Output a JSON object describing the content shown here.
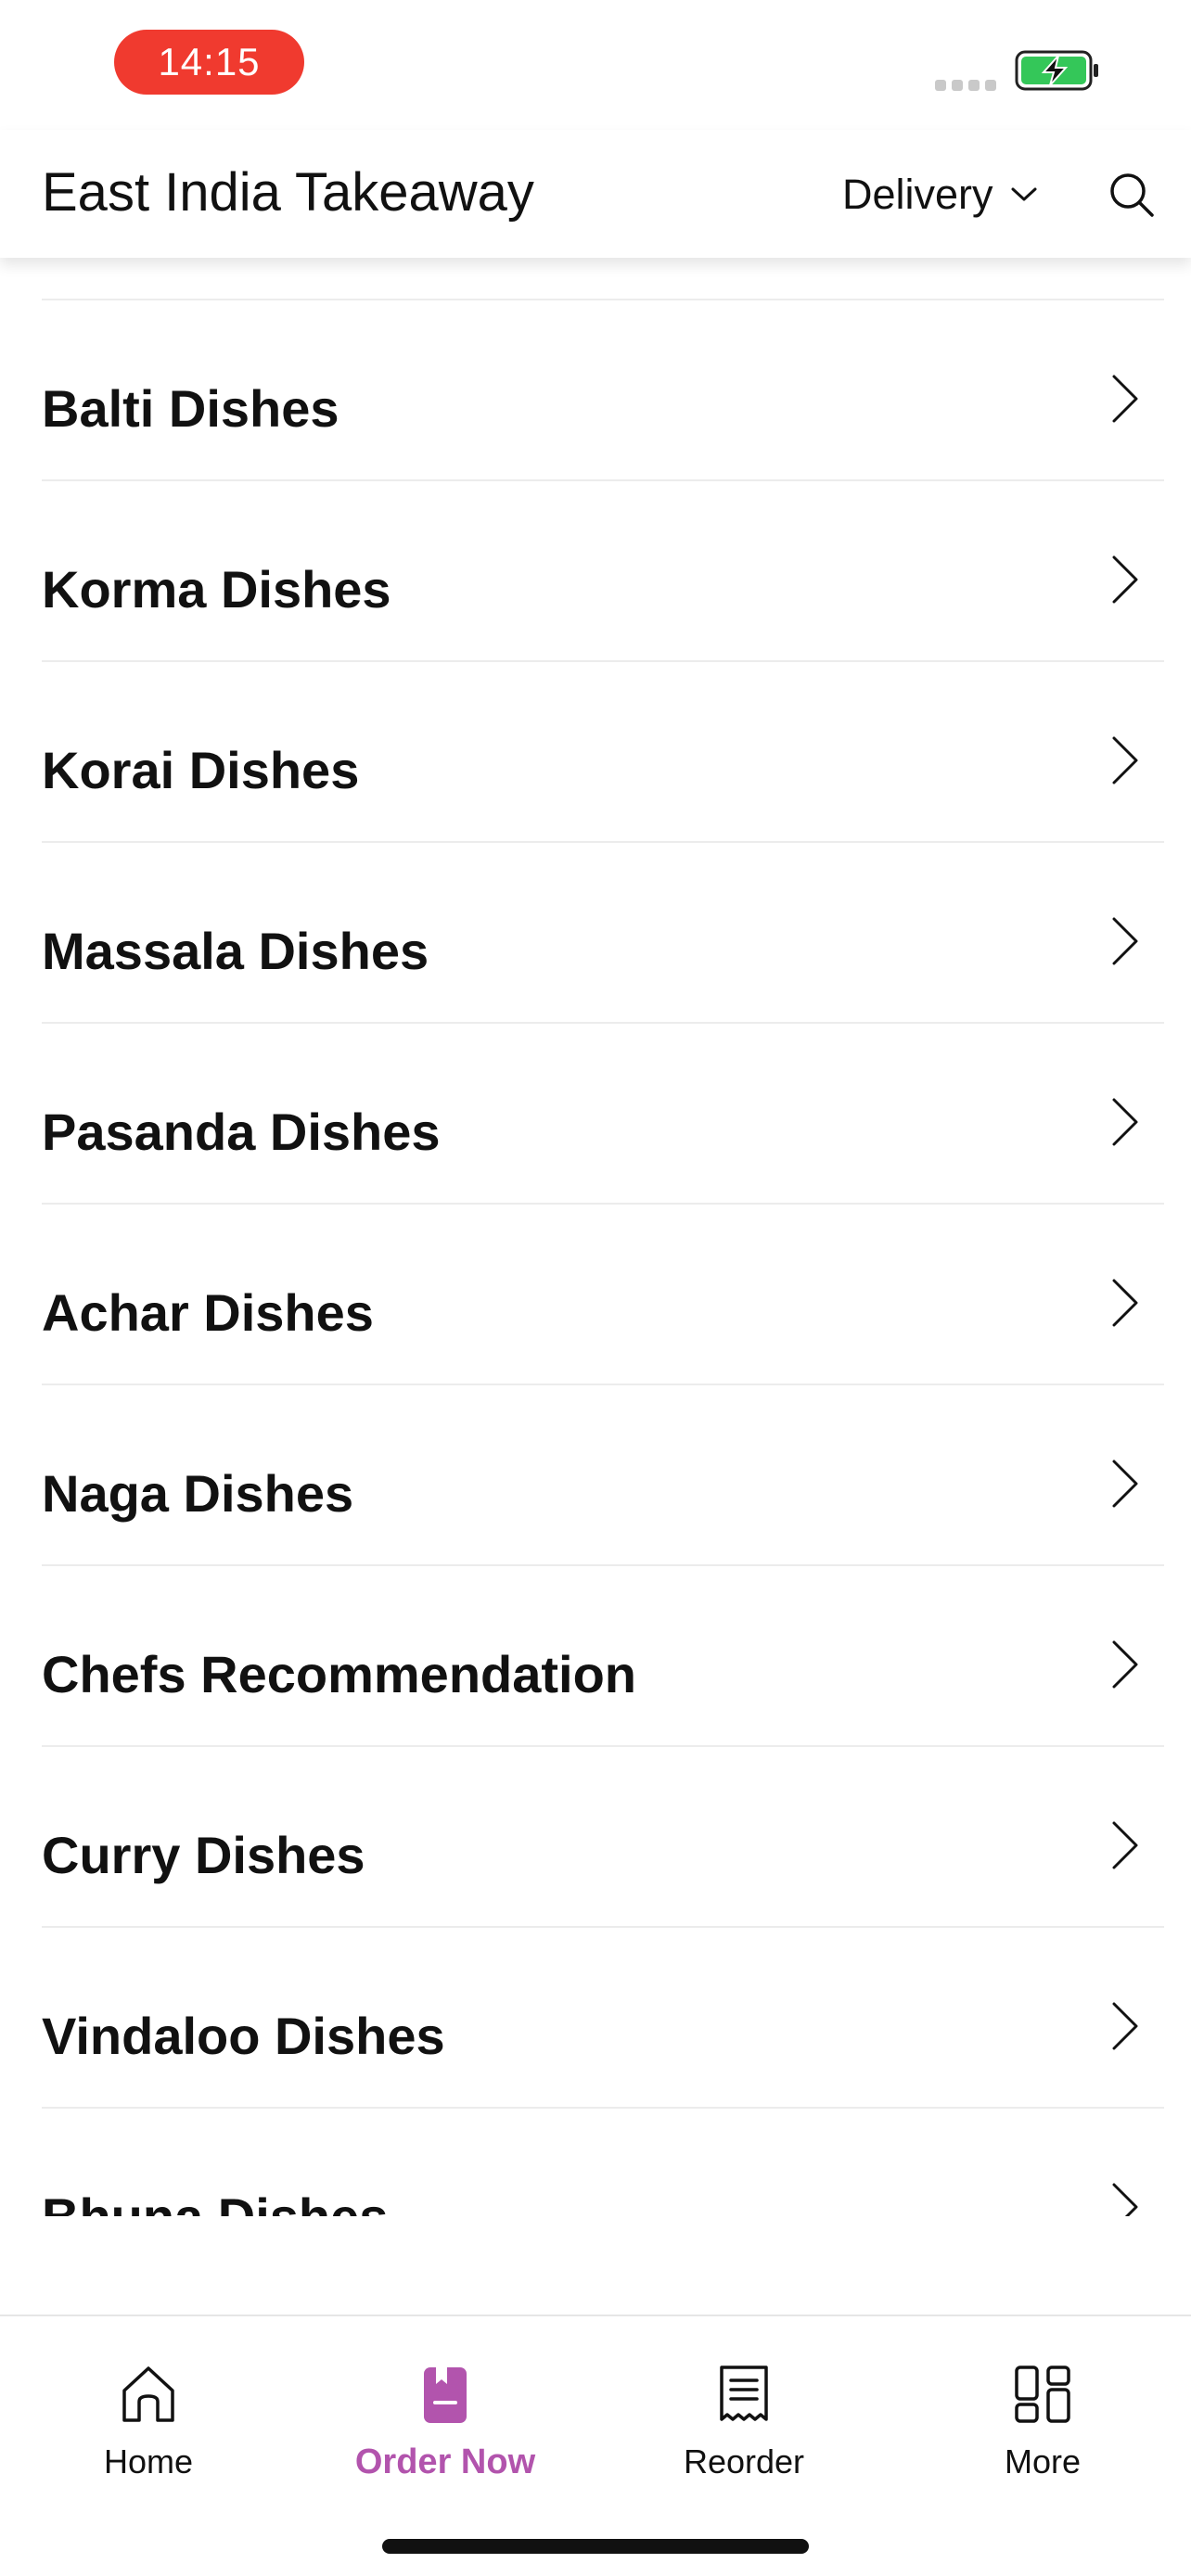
{
  "status_bar": {
    "time": "14:15",
    "battery_icon": "battery-charging-icon",
    "battery_color": "#34c759"
  },
  "header": {
    "title": "East India Takeaway",
    "delivery_mode": "Delivery",
    "search_icon": "search-icon"
  },
  "categories": [
    {
      "label": "Balti Dishes"
    },
    {
      "label": "Korma Dishes"
    },
    {
      "label": "Korai Dishes"
    },
    {
      "label": "Massala Dishes"
    },
    {
      "label": "Pasanda Dishes"
    },
    {
      "label": "Achar Dishes"
    },
    {
      "label": "Naga Dishes"
    },
    {
      "label": "Chefs Recommendation"
    },
    {
      "label": "Curry Dishes"
    },
    {
      "label": "Vindaloo Dishes"
    },
    {
      "label": "Bhuna Dishes"
    }
  ],
  "bottom_nav": {
    "active_color": "#b254ad",
    "items": [
      {
        "label": "Home",
        "icon": "home-icon"
      },
      {
        "label": "Order Now",
        "icon": "order-book-icon",
        "active": true
      },
      {
        "label": "Reorder",
        "icon": "receipt-icon"
      },
      {
        "label": "More",
        "icon": "grid-icon"
      }
    ]
  }
}
